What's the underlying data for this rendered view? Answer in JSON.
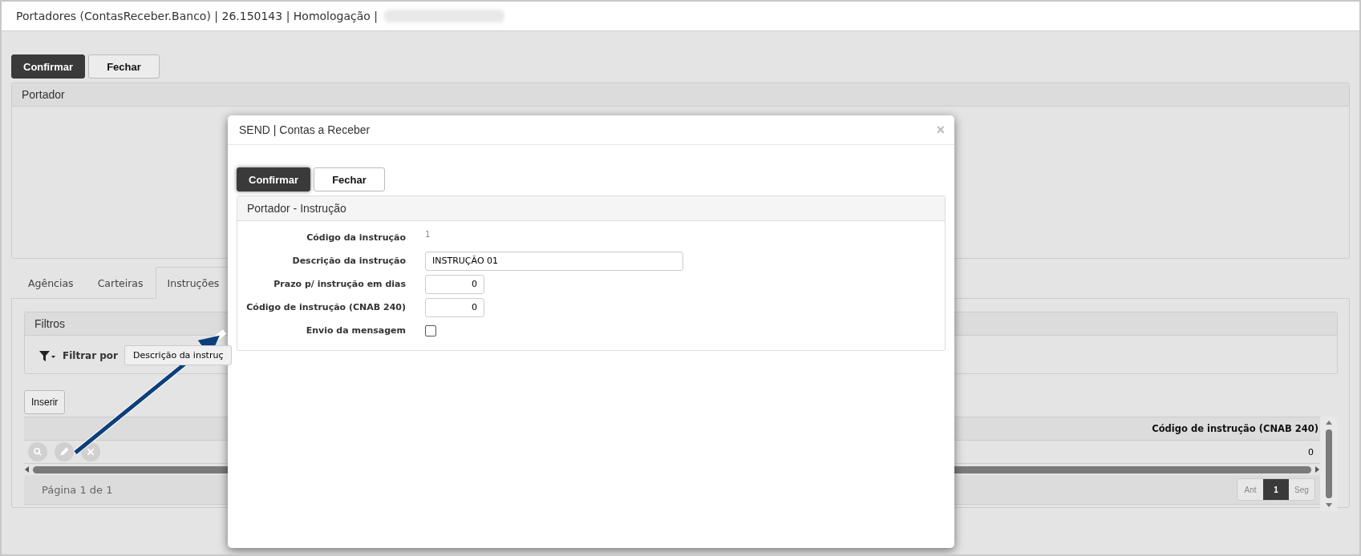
{
  "header": {
    "title": "Portadores (ContasReceber.Banco) | 26.150143 | Homologação |"
  },
  "toolbar": {
    "buttons": [
      {
        "label": "Confirmar",
        "kind": "primary"
      },
      {
        "label": "Fechar",
        "kind": "default"
      }
    ]
  },
  "portador_panel": {
    "title": "Portador"
  },
  "tabs": [
    {
      "label": "Agências",
      "selected": false
    },
    {
      "label": "Carteiras",
      "selected": false
    },
    {
      "label": "Instruções",
      "selected": true
    }
  ],
  "filters": {
    "title": "Filtros",
    "filter_label": "Filtrar por",
    "select_value": "Descrição da instruç"
  },
  "insert_button": {
    "label": "Inserir"
  },
  "grid": {
    "columns": [
      {
        "label": "Código de instrução (CNAB 240)"
      }
    ],
    "rows": [
      {
        "cells": [
          "0"
        ]
      }
    ],
    "pagination": {
      "info": "Página 1 de 1",
      "prev": "Ant",
      "next": "Seg",
      "pages": [
        {
          "label": "1",
          "selected": true
        }
      ]
    }
  },
  "modal": {
    "title": "SEND | Contas a Receber",
    "close": "×",
    "buttons": [
      {
        "label": "Confirmar",
        "kind": "primary"
      },
      {
        "label": "Fechar",
        "kind": "default"
      }
    ],
    "panel_title": "Portador - Instrução",
    "fields": [
      {
        "label": "Código da instrução",
        "kind": "readonly",
        "value": "1"
      },
      {
        "label": "Descrição da instrução",
        "kind": "text",
        "value": "INSTRUÇÃO 01"
      },
      {
        "label": "Prazo p/ instrução em dias",
        "kind": "number",
        "value": "0"
      },
      {
        "label": "Código de instrução (CNAB 240)",
        "kind": "number",
        "value": "0"
      },
      {
        "label": "Envio da mensagem",
        "kind": "checkbox",
        "checked": false
      }
    ]
  }
}
